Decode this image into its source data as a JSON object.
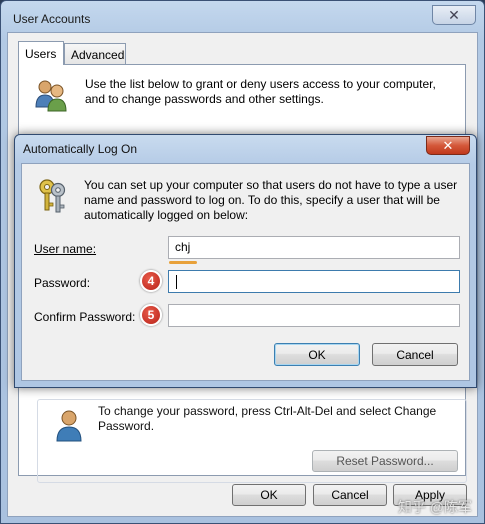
{
  "parent": {
    "title": "User Accounts",
    "close_glyph": "✕",
    "tabs": [
      {
        "label": "Users"
      },
      {
        "label": "Advanced"
      }
    ],
    "intro_text": "Use the list below to grant or deny users access to your computer, and to change passwords and other settings.",
    "password_section": {
      "text": "To change your password, press Ctrl-Alt-Del and select Change Password.",
      "reset_button": "Reset Password..."
    },
    "buttons": {
      "ok": "OK",
      "cancel": "Cancel",
      "apply": "Apply"
    },
    "watermark": "知乎 @陈军"
  },
  "dialog": {
    "title": "Automatically Log On",
    "close_glyph": "✕",
    "description": "You can set up your computer so that users do not have to type a user name and password to log on. To do this, specify a user that will be automatically logged on below:",
    "fields": {
      "username": {
        "label": "User name:",
        "value": "chj"
      },
      "password": {
        "label": "Password:",
        "value": ""
      },
      "confirm": {
        "label": "Confirm Password:",
        "value": ""
      }
    },
    "badges": {
      "password": "4",
      "confirm": "5"
    },
    "buttons": {
      "ok": "OK",
      "cancel": "Cancel"
    }
  },
  "colors": {
    "title_bar": "#b5cbe6",
    "close_button_active": "#c0391c",
    "badge": "#c62a1f",
    "highlight_underline": "#e8a13a"
  }
}
